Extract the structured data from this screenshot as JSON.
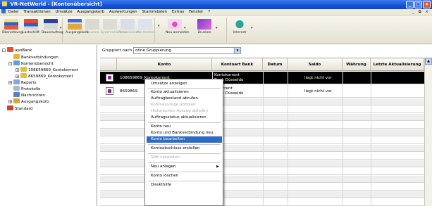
{
  "window": {
    "title": "VR-NetWorld - [Kontenübersicht]",
    "buttons": [
      "_",
      "□",
      "×"
    ]
  },
  "menubar": {
    "items": [
      "Datei",
      "Transaktionen",
      "Umsätze",
      "Ausgangskorb",
      "Auswertungen",
      "Stammdaten",
      "Extras",
      "Fenster",
      "?"
    ],
    "mdi_controls": "_ ⧉ ×"
  },
  "toolbar": {
    "buttons": [
      {
        "label": "Übersetzung",
        "icon": "overview-icon",
        "enabled": true
      },
      {
        "label": "Lastschrift",
        "icon": "direct-debit-icon",
        "enabled": true
      },
      {
        "label": "Dauerauftrag",
        "icon": "standing-order-icon",
        "enabled": true
      },
      {
        "label": "Ausgangskorb",
        "icon": "outbox-icon",
        "enabled": true
      },
      {
        "label": "Drucken",
        "icon": "print-icon",
        "enabled": false
      },
      {
        "label": "Synchronisieren",
        "icon": "sync-icon",
        "enabled": false
      },
      {
        "label": "Aktualisieren",
        "icon": "refresh-icon",
        "enabled": false
      },
      {
        "label": "Alle Konten...",
        "icon": "all-accounts-icon",
        "enabled": false
      },
      {
        "label": "Neu anmelden",
        "icon": "login-icon",
        "enabled": true
      },
      {
        "label": "Drucken",
        "icon": "printer-icon",
        "enabled": true
      },
      {
        "label": "Internet",
        "icon": "internet-icon",
        "enabled": true
      }
    ]
  },
  "tree": {
    "nodes": [
      {
        "label": "apoBank",
        "level": 0,
        "expander": "-",
        "icon": "bank-icon"
      },
      {
        "label": "Bankverbindungen",
        "level": 1,
        "expander": "",
        "icon": "folder-icon"
      },
      {
        "label": "Kontenübersicht",
        "level": 1,
        "expander": "-",
        "icon": "folder-open-icon"
      },
      {
        "label": "108659869_Kontokorrent",
        "level": 2,
        "expander": "+",
        "icon": "account-icon"
      },
      {
        "label": "8659869_Kontokorrent",
        "level": 2,
        "expander": "+",
        "icon": "account-icon"
      },
      {
        "label": "Reports",
        "level": 1,
        "expander": "+",
        "icon": "reports-icon"
      },
      {
        "label": "Protokolle",
        "level": 1,
        "expander": "",
        "icon": "protocol-icon"
      },
      {
        "label": "Nachrichten",
        "level": 1,
        "expander": "",
        "icon": "messages-icon"
      },
      {
        "label": "Ausgangskorb",
        "level": 1,
        "expander": "+",
        "icon": "outbox-icon"
      },
      {
        "label": "Standard",
        "level": 0,
        "expander": "",
        "icon": "standard-icon"
      }
    ]
  },
  "grouping": {
    "label": "Gruppiert nach",
    "value": "ohne Gruppierung"
  },
  "table": {
    "columns": [
      "Konto",
      "Kontoart Bank",
      "Datum",
      "Saldo",
      "Währung",
      "Letzte Aktualisierung"
    ],
    "rows": [
      {
        "konto": "108659869_Kontokorrent",
        "kontoart": "Kontokorrent",
        "bank": "Bank Düsseldo",
        "datum": "",
        "saldo": "liegt nicht vor",
        "waehrung": "",
        "letzte": "",
        "selected": true
      },
      {
        "konto": "8659869",
        "kontoart": "tokorrent",
        "bank": "Bank Düsseldo",
        "datum": "",
        "saldo": "liegt nicht vor",
        "waehrung": "",
        "letzte": "",
        "selected": false
      }
    ]
  },
  "context_menu": {
    "items": [
      {
        "label": "Umsätze anzeigen",
        "enabled": true
      },
      {
        "sep": true
      },
      {
        "label": "Konto aktualisieren",
        "enabled": true
      },
      {
        "label": "Auftragbestand abrufen",
        "enabled": true
      },
      {
        "label": "Kontoauszüge abholen",
        "enabled": false
      },
      {
        "label": "Historischen Auszug abholen",
        "enabled": false
      },
      {
        "label": "Auftragsstatus aktualisieren",
        "enabled": true
      },
      {
        "sep": true
      },
      {
        "label": "Konto neu",
        "enabled": true
      },
      {
        "label": "Konto und Bankverbindung neu",
        "enabled": true
      },
      {
        "label": "Konto bearbeiten",
        "enabled": true,
        "highlighted": true
      },
      {
        "sep": true
      },
      {
        "label": "Kontoabschluss erstellen",
        "enabled": true
      },
      {
        "sep": true
      },
      {
        "label": "Stift verwalten",
        "enabled": false
      },
      {
        "sep": true
      },
      {
        "label": "Neu anlegen",
        "enabled": true,
        "submenu": true
      },
      {
        "sep": true
      },
      {
        "label": "Konto löschen",
        "enabled": true
      },
      {
        "sep": true
      },
      {
        "label": "Direkthilfe",
        "enabled": true
      }
    ]
  },
  "colors": {
    "titlebar": "#1753d6",
    "selection": "#000000",
    "menu_highlight": "#316ac5",
    "toolbar_bg": "#ece9d8"
  }
}
